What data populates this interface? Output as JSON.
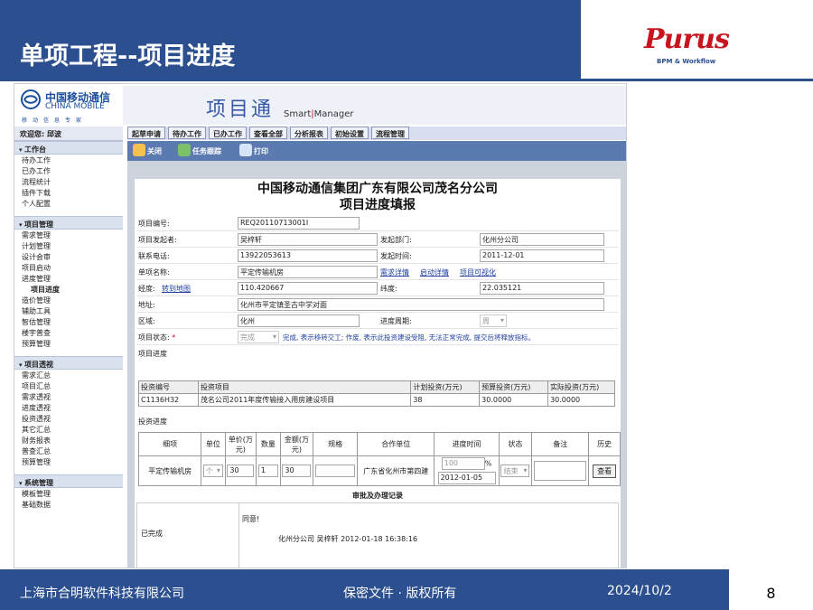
{
  "slide": {
    "title": "单项工程--项目进度",
    "logo": {
      "name": "Purus",
      "tagline": "BPM & Workflow"
    },
    "footer": {
      "company": "上海市合明软件科技有限公司",
      "confidential": "保密文件 ·  版权所有",
      "date": "2024/10/2",
      "page": "8"
    }
  },
  "app": {
    "brand_cn": "中国移动通信",
    "brand_en": "CHINA MOBILE",
    "slogan": "移动信息专家",
    "product_cn": "项目通",
    "product_en_prefix": "Smart",
    "product_en_sep": "|",
    "product_en_suffix": "Manager",
    "welcome": "欢迎您: 邱波",
    "nav": [
      "起草申请",
      "待办工作",
      "已办工作",
      "查看全部",
      "分析报表",
      "初始设置",
      "流程管理"
    ],
    "toolbar": {
      "close": "关闭",
      "track": "任务跟踪",
      "print": "打印"
    },
    "sidebar": [
      {
        "title": "工作台",
        "items": [
          "待办工作",
          "已办工作",
          "流程统计",
          "插件下载",
          "个人配置"
        ]
      },
      {
        "title": "项目管理",
        "items": [
          "需求管理",
          "计划管理",
          "设计会审",
          "项目启动",
          "进度管理",
          "项目进度",
          "造价管理",
          "辅助工具",
          "智估管理",
          "楼宇普查",
          "预算管理"
        ]
      },
      {
        "title": "项目透视",
        "items": [
          "需求汇总",
          "项目汇总",
          "需求透视",
          "进度透视",
          "投资透视",
          "其它汇总",
          "财务报表",
          "普查汇总",
          "预算管理"
        ]
      },
      {
        "title": "系统管理",
        "items": [
          "模板管理",
          "基础数据"
        ]
      }
    ]
  },
  "form": {
    "title": "中国移动通信集团广东有限公司茂名分公司",
    "subtitle": "项目进度填报",
    "fields": {
      "project_no_label": "项目编号:",
      "project_no": "REQ20110713001I",
      "initiator_label": "项目发起者:",
      "initiator": "吴梓轩",
      "dept_label": "发起部门:",
      "dept": "化州分公司",
      "phone_label": "联系电话:",
      "phone": "13922053613",
      "start_time_label": "发起时间:",
      "start_time": "2011-12-01",
      "name_label": "单项名称:",
      "name": "平定传输机房",
      "link_req": "需求详情",
      "link_start": "启动详情",
      "link_visual": "项目可视化",
      "lon_label": "经度:",
      "lon_link": "转到地图",
      "lon": "110.420667",
      "lat_label": "纬度:",
      "lat": "22.035121",
      "addr_label": "地址:",
      "addr": "化州市平定镇圣古中学对面",
      "area_label": "区域:",
      "area": "化州",
      "cycle_label": "进度周期:",
      "cycle": "周",
      "status_label": "项目状态:",
      "status_req": "*",
      "status": "完成",
      "status_note": "完成, 表示移转交工; 作废, 表示此投资建设受阻, 无法正常完成, 提交后将释放指标。",
      "section_progress": "项目进度"
    },
    "invest_table": {
      "headers": [
        "投资编号",
        "投资项目",
        "计划投资(万元)",
        "预算投资(万元)",
        "实际投资(万元)"
      ],
      "row": [
        "C1136H32",
        "茂名公司2011年度传输接入用房建设项目",
        "38",
        "30.0000",
        "30.0000"
      ]
    },
    "section_invest": "投资进度",
    "progress_table": {
      "headers": [
        "细项",
        "单位",
        "单价(万元)",
        "数量",
        "金额(万元)",
        "规格",
        "合作单位",
        "进度时间",
        "状态",
        "备注",
        "历史"
      ],
      "row": {
        "item": "平定传输机房",
        "unit": "个",
        "price": "30",
        "qty": "1",
        "amount": "30",
        "spec": "",
        "partner": "广东省化州市第四建",
        "pct": "100",
        "pct_unit": "%",
        "date": "2012-01-05",
        "state": "结束",
        "remark": "",
        "history": "查看"
      }
    },
    "approval": {
      "title": "审批及办理记录",
      "state": "已完成",
      "comment": "同意!",
      "signer": "化州分公司 吴梓轩 2012-01-18 16:38:16"
    }
  }
}
